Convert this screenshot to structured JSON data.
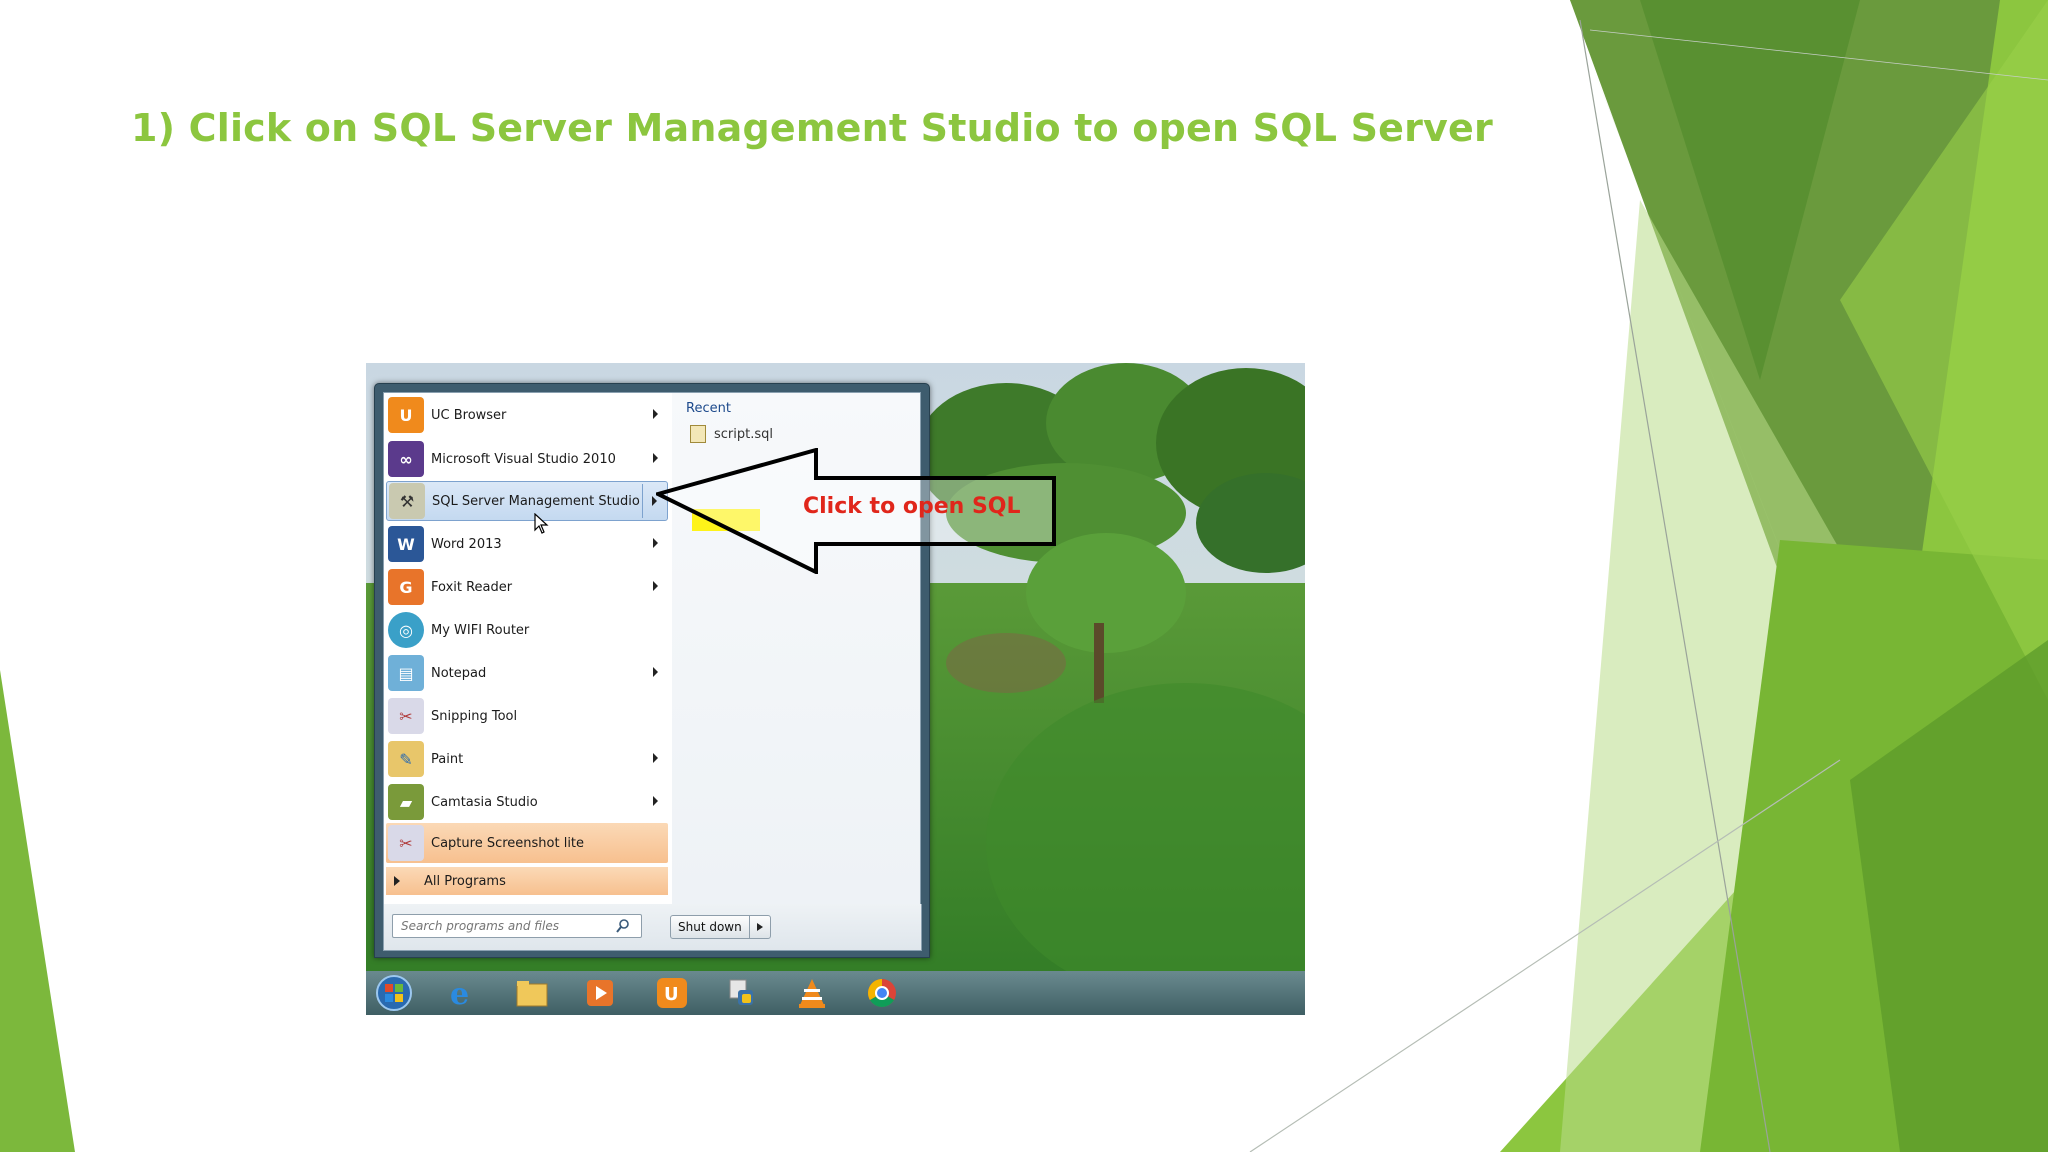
{
  "slide": {
    "title": "1) Click on SQL Server Management Studio to open SQL Server"
  },
  "start_menu": {
    "programs": [
      {
        "label": "UC Browser",
        "icon": "uc-browser-icon",
        "has_submenu": true
      },
      {
        "label": "Microsoft Visual Studio 2010",
        "icon": "visual-studio-icon",
        "has_submenu": true
      },
      {
        "label": "SQL Server Management Studio",
        "icon": "sql-server-icon",
        "has_submenu": true,
        "hovered": true
      },
      {
        "label": "Word 2013",
        "icon": "word-icon",
        "has_submenu": true
      },
      {
        "label": "Foxit Reader",
        "icon": "foxit-reader-icon",
        "has_submenu": true
      },
      {
        "label": "My WIFI Router",
        "icon": "wifi-router-icon",
        "has_submenu": false
      },
      {
        "label": "Notepad",
        "icon": "notepad-icon",
        "has_submenu": true
      },
      {
        "label": "Snipping Tool",
        "icon": "snipping-tool-icon",
        "has_submenu": false
      },
      {
        "label": "Paint",
        "icon": "paint-icon",
        "has_submenu": true
      },
      {
        "label": "Camtasia Studio",
        "icon": "camtasia-icon",
        "has_submenu": true
      },
      {
        "label": "Capture Screenshot lite",
        "icon": "capture-screenshot-icon",
        "has_submenu": false,
        "pinned": true
      }
    ],
    "all_programs": "All Programs",
    "recent": {
      "title": "Recent",
      "items": [
        "script.sql"
      ]
    },
    "search_placeholder": "Search programs and files",
    "shutdown_label": "Shut down"
  },
  "callout": {
    "text": "Click to open SQL",
    "color": "#e0261b"
  },
  "taskbar": {
    "items": [
      "start-orb",
      "internet-explorer-icon",
      "file-explorer-icon",
      "media-player-icon",
      "uc-browser-icon",
      "python-icon",
      "vlc-icon",
      "chrome-icon"
    ]
  },
  "colors": {
    "title": "#8cc63f",
    "accent_dark": "#4e8a2a",
    "accent_light": "#a9d26a"
  }
}
